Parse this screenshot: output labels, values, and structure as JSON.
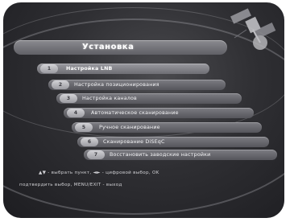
{
  "menu": {
    "title": "Установка",
    "items": [
      {
        "badge": "1",
        "label": "Настройка LNB",
        "active": true
      },
      {
        "badge": "2",
        "label": "Настройка позиционирования",
        "active": false
      },
      {
        "badge": "3",
        "label": "Настройка каналов",
        "active": false
      },
      {
        "badge": "4",
        "label": "Автоматическое сканирование",
        "active": false
      },
      {
        "badge": "5",
        "label": "Ручное сканирование",
        "active": false
      },
      {
        "badge": "6",
        "label": "Сканирование DiSEqC",
        "active": false
      },
      {
        "badge": "7",
        "label": "Восстановить заводские настройки",
        "active": false
      }
    ]
  },
  "hints": {
    "line1": "▲▼ - выбрать пункт, ◄► - цифровой выбор, OK",
    "line2": "подтвердить выбор, MENU/EXIT - выход"
  }
}
